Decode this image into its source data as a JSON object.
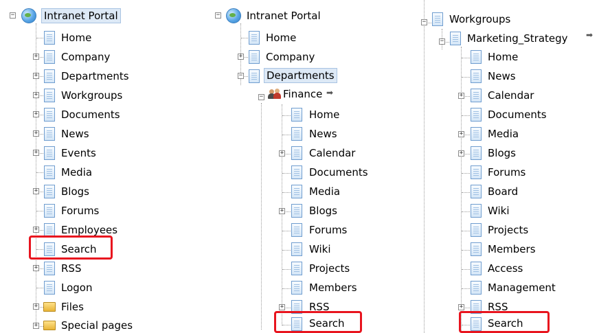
{
  "panel1": {
    "root": "Intranet Portal",
    "items": [
      "Home",
      "Company",
      "Departments",
      "Workgroups",
      "Documents",
      "News",
      "Events",
      "Media",
      "Blogs",
      "Forums",
      "Employees",
      "Search",
      "RSS",
      "Logon",
      "Files",
      "Special pages"
    ]
  },
  "panel2": {
    "root": "Intranet Portal",
    "items": [
      "Home",
      "Company",
      "Departments"
    ],
    "group": "Finance",
    "children": [
      "Home",
      "News",
      "Calendar",
      "Documents",
      "Media",
      "Blogs",
      "Forums",
      "Wiki",
      "Projects",
      "Members",
      "RSS",
      "Search"
    ]
  },
  "panel3": {
    "root": "Workgroups",
    "group": "Marketing_Strategy",
    "children": [
      "Home",
      "News",
      "Calendar",
      "Documents",
      "Media",
      "Blogs",
      "Forums",
      "Board",
      "Wiki",
      "Projects",
      "Members",
      "Access",
      "Management",
      "RSS",
      "Search"
    ]
  },
  "icons": {
    "root": "globe-icon",
    "page": "page-icon",
    "folder": "folder-icon",
    "group": "group-icon",
    "arrow": "arrow-right-icon",
    "toggle_open": "minus-toggle",
    "toggle_closed": "plus-toggle"
  }
}
